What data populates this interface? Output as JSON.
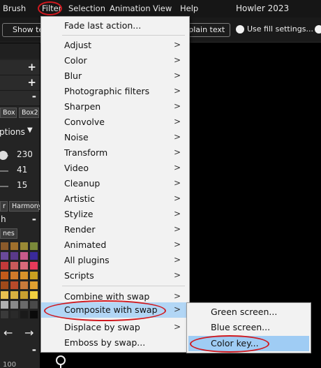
{
  "menubar": {
    "items": [
      "Brush",
      "Filter",
      "Selection",
      "Animation",
      "View",
      "Help"
    ],
    "app_title": "Howler 2023"
  },
  "toolbar": {
    "show_button": "Show te",
    "plain_text_button": "s plain text",
    "use_fill_settings": "Use fill settings..."
  },
  "left_panel": {
    "tabs1": [
      "Box",
      "Box2"
    ],
    "options_label": "ptions",
    "values": [
      "230",
      "41",
      "15"
    ],
    "tabs2": [
      "r",
      "Harmony"
    ],
    "item_h": "h",
    "tab3": "nes",
    "bottom_value": "100"
  },
  "filter_menu": {
    "items": [
      {
        "label": "Fade last action...",
        "submenu": false
      },
      {
        "label": "Adjust",
        "submenu": true
      },
      {
        "label": "Color",
        "submenu": true
      },
      {
        "label": "Blur",
        "submenu": true
      },
      {
        "label": "Photographic filters",
        "submenu": true
      },
      {
        "label": "Sharpen",
        "submenu": true
      },
      {
        "label": "Convolve",
        "submenu": true
      },
      {
        "label": "Noise",
        "submenu": true
      },
      {
        "label": "Transform",
        "submenu": true
      },
      {
        "label": "Video",
        "submenu": true
      },
      {
        "label": "Cleanup",
        "submenu": true
      },
      {
        "label": "Artistic",
        "submenu": true
      },
      {
        "label": "Stylize",
        "submenu": true
      },
      {
        "label": "Render",
        "submenu": true
      },
      {
        "label": "Animated",
        "submenu": true
      },
      {
        "label": "All plugins",
        "submenu": true
      },
      {
        "label": "Scripts",
        "submenu": true
      },
      {
        "label": "Combine with swap",
        "submenu": true
      },
      {
        "label": "Composite with swap",
        "submenu": true,
        "highlighted": true
      },
      {
        "label": "Displace by swap",
        "submenu": true
      },
      {
        "label": "Emboss by swap...",
        "submenu": false
      }
    ],
    "arrow_glyph": ">"
  },
  "composite_submenu": {
    "items": [
      {
        "label": "Green screen..."
      },
      {
        "label": "Blue screen..."
      },
      {
        "label": "Color key...",
        "highlighted": true
      }
    ]
  },
  "colors": {
    "annotation_red": "#d0191f",
    "highlight_blue": "#b2d6f5",
    "menu_bg": "#f2f2f2"
  },
  "palette": [
    [
      "#8a5a2b",
      "#a0702c",
      "#9a8a35",
      "#7a8a3a"
    ],
    [
      "#6a4a9a",
      "#5a3a8a",
      "#c85a8a",
      "#3a2a9a"
    ],
    [
      "#c23a3a",
      "#c85a5a",
      "#d86a7a",
      "#e63a5a"
    ],
    [
      "#c25a1a",
      "#d07a2a",
      "#d8922a",
      "#c8a020"
    ],
    [
      "#a04a1a",
      "#b84a2a",
      "#c87a3a",
      "#e0a030"
    ],
    [
      "#e8c050",
      "#d8b040",
      "#c8a030",
      "#f0d040"
    ],
    [
      "#b0b0b0",
      "#8a8a8a",
      "#6a6a6a",
      "#4a4a4a"
    ],
    [
      "#3a3a3a",
      "#2a2a2a",
      "#1a1a1a",
      "#0a0a0a"
    ]
  ]
}
